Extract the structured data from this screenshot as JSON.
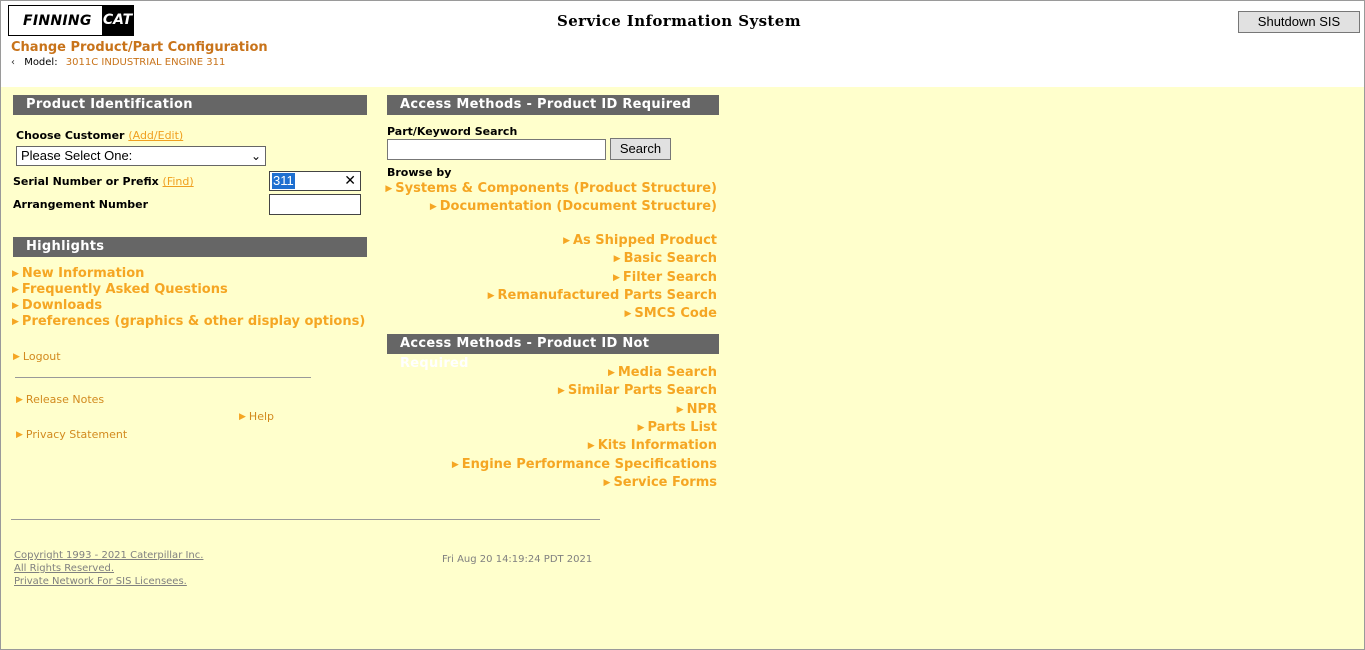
{
  "header": {
    "logo_finning": "FINNING",
    "logo_cat": "CAT",
    "system_title": "Service Information System",
    "shutdown_button": "Shutdown SIS",
    "change_config_title": "Change Product/Part Configuration",
    "model_label": "Model:",
    "model_value": "3011C INDUSTRIAL ENGINE 311"
  },
  "product_identification": {
    "heading": "Product Identification",
    "customer_label": "Choose Customer",
    "customer_link": "(Add/Edit)",
    "customer_select_value": "Please Select One:",
    "serial_label": "Serial Number or Prefix",
    "serial_link": "(Find)",
    "serial_value": "311",
    "arrangement_label": "Arrangement Number",
    "arrangement_value": ""
  },
  "highlights": {
    "heading": "Highlights",
    "items": [
      "New Information",
      "Frequently Asked Questions",
      "Downloads",
      "Preferences (graphics & other display options)"
    ],
    "logout": "Logout",
    "release_notes": "Release Notes",
    "help": "Help",
    "privacy": "Privacy Statement"
  },
  "access_required": {
    "heading": "Access Methods - Product ID Required",
    "search_label": "Part/Keyword Search",
    "search_value": "",
    "search_button": "Search",
    "browse_label": "Browse by",
    "browse_items": [
      "Systems & Components (Product Structure)",
      "Documentation (Document Structure)"
    ],
    "links": [
      "As Shipped Product",
      "Basic Search",
      "Filter Search",
      "Remanufactured Parts Search",
      "SMCS Code"
    ]
  },
  "access_not_required": {
    "heading": "Access Methods - Product ID Not Required",
    "links": [
      "Media Search",
      "Similar Parts Search",
      "NPR",
      "Parts List",
      "Kits Information",
      "Engine Performance Specifications",
      "Service Forms"
    ]
  },
  "footer": {
    "copyright": "Copyright 1993 - 2021 Caterpillar Inc.",
    "rights": "All Rights Reserved.",
    "private": "Private Network For SIS Licensees.",
    "timestamp": "Fri Aug 20 14:19:24 PDT 2021"
  }
}
